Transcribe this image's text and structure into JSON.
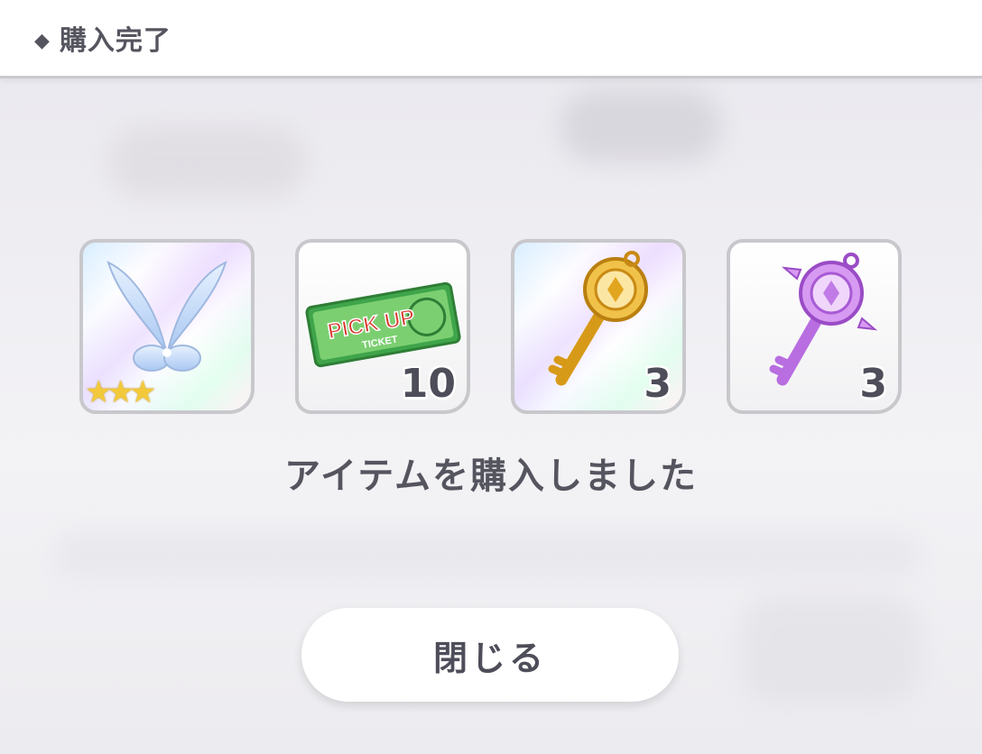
{
  "dialog": {
    "title": "購入完了",
    "title_icon": "diamond-icon",
    "message": "アイテムを購入しました",
    "close_label": "閉じる"
  },
  "items": [
    {
      "name": "fairy-wings",
      "icon": "wings-icon",
      "count": null,
      "stars": 3,
      "rarity_bg": "prism"
    },
    {
      "name": "pick-up-ticket",
      "icon": "ticket-icon",
      "count": "10",
      "ticket_text": "PICK UP",
      "ticket_subtext": "TICKET"
    },
    {
      "name": "gold-key",
      "icon": "gold-key-icon",
      "count": "3",
      "rarity_bg": "prism"
    },
    {
      "name": "purple-key",
      "icon": "purple-key-icon",
      "count": "3"
    }
  ],
  "colors": {
    "text": "#55555f",
    "header_bg": "#ffffff",
    "item_border": "#c8c8cc",
    "star": "#f3c93b",
    "ticket_green": "#3a9a3a",
    "ticket_red": "#d8352b",
    "gold": "#e2a51f",
    "purple": "#c07be6"
  }
}
